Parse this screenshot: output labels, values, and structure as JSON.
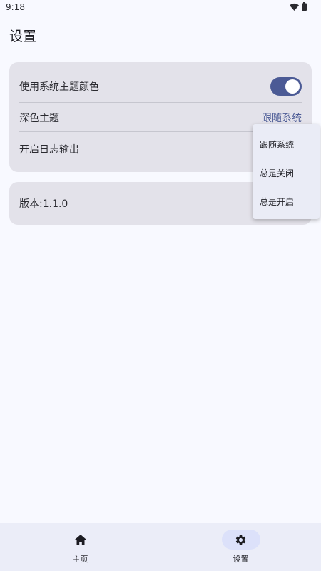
{
  "status_bar": {
    "time": "9:18"
  },
  "header": {
    "title": "设置"
  },
  "settings": {
    "system_theme_color": {
      "label": "使用系统主题颜色",
      "enabled": true
    },
    "dark_theme": {
      "label": "深色主题",
      "value": "跟随系统"
    },
    "log_output": {
      "label": "开启日志输出"
    }
  },
  "version": {
    "label": "版本:1.1.0"
  },
  "dropdown": {
    "options": [
      "跟随系统",
      "总是关闭",
      "总是开启"
    ]
  },
  "bottom_nav": {
    "items": [
      {
        "label": "主页",
        "icon": "home-icon",
        "active": false
      },
      {
        "label": "设置",
        "icon": "gear-icon",
        "active": true
      }
    ]
  },
  "colors": {
    "accent": "#4b5a95",
    "card_bg": "#e3e2ea",
    "background": "#f8f9ff",
    "nav_bg": "#ebedf8",
    "active_pill": "#dce1fa"
  }
}
